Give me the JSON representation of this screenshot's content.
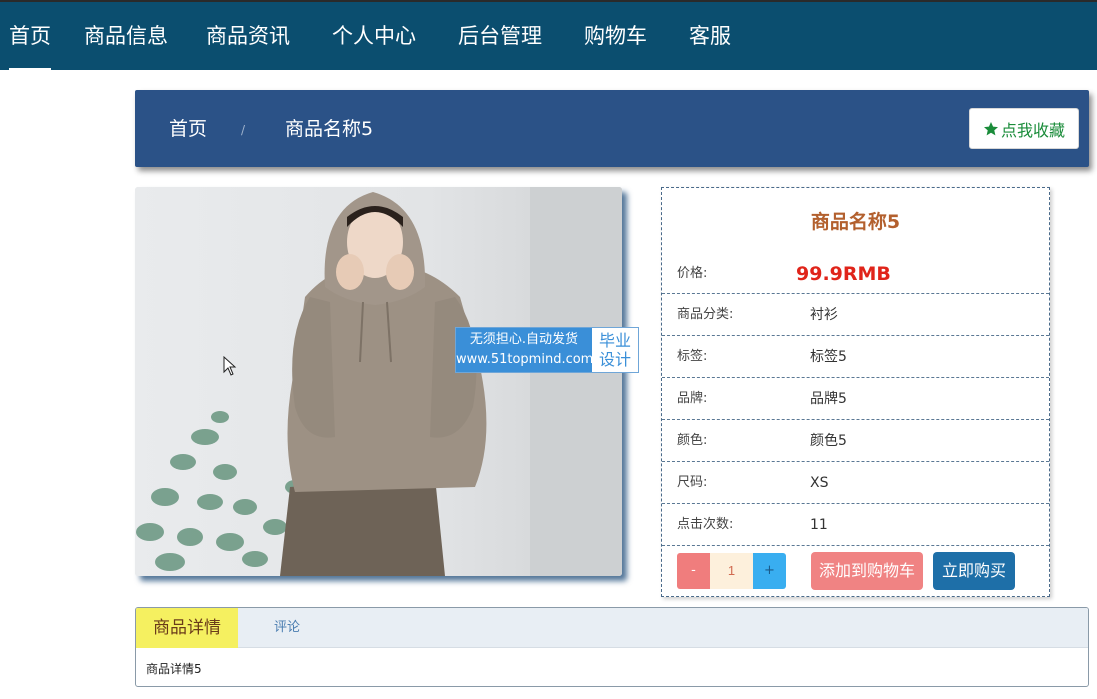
{
  "nav": {
    "items": [
      {
        "label": "首页",
        "active": true
      },
      {
        "label": "商品信息",
        "active": false
      },
      {
        "label": "商品资讯",
        "active": false
      },
      {
        "label": "个人中心",
        "active": false
      },
      {
        "label": "后台管理",
        "active": false
      },
      {
        "label": "购物车",
        "active": false
      },
      {
        "label": "客服",
        "active": false
      }
    ]
  },
  "breadcrumb": {
    "home": "首页",
    "separator": "/",
    "current": "商品名称5"
  },
  "favorite": {
    "label": "点我收藏",
    "icon": "star-icon",
    "color": "#1a8c3a"
  },
  "product": {
    "title": "商品名称5",
    "price_label": "价格:",
    "price": "99.9RMB",
    "rows": [
      {
        "label": "商品分类:",
        "value": "衬衫"
      },
      {
        "label": "标签:",
        "value": "标签5"
      },
      {
        "label": "品牌:",
        "value": "品牌5"
      },
      {
        "label": "颜色:",
        "value": "颜色5"
      },
      {
        "label": "尺码:",
        "value": "XS"
      },
      {
        "label": "点击次数:",
        "value": "11"
      }
    ]
  },
  "quantity": {
    "minus": "-",
    "value": "1",
    "plus": "+"
  },
  "actions": {
    "add_to_cart": "添加到购物车",
    "buy_now": "立即购买"
  },
  "tabs": {
    "detail": "商品详情",
    "review": "评论",
    "content": "商品详情5"
  },
  "watermark": {
    "line1": "无须担心.自动发货",
    "line2": "www.51topmind.com",
    "right1": "毕业",
    "right2": "设计"
  },
  "colors": {
    "nav_bg": "#0b4e6f",
    "crumb_bg": "#2b5287",
    "price": "#e0241a",
    "title": "#b3602e"
  }
}
